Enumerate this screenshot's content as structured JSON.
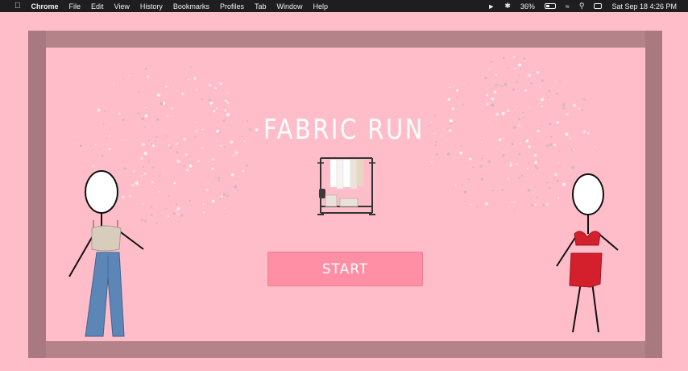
{
  "menubar": {
    "apple_icon": "apple-logo-icon",
    "app_name": "Chrome",
    "menus": [
      "File",
      "Edit",
      "View",
      "History",
      "Bookmarks",
      "Profiles",
      "Tab",
      "Window",
      "Help"
    ],
    "battery_percent": "36%",
    "datetime": "Sat Sep 18  4:26 PM"
  },
  "game": {
    "title": "FABRIC RUN",
    "start_label": "START"
  },
  "colors": {
    "background": "#ffbdc9",
    "frame": "#b48289",
    "button": "#ff8fa4",
    "button_text": "#ffffff",
    "title_text": "#ffffff",
    "left_top": "#d8ccbd",
    "left_jeans": "#5b86b6",
    "right_outfit": "#d3202c"
  },
  "icons": {
    "clothing_rack": "clothing-rack-icon",
    "sparkles": "sparkle-cluster-icon"
  }
}
